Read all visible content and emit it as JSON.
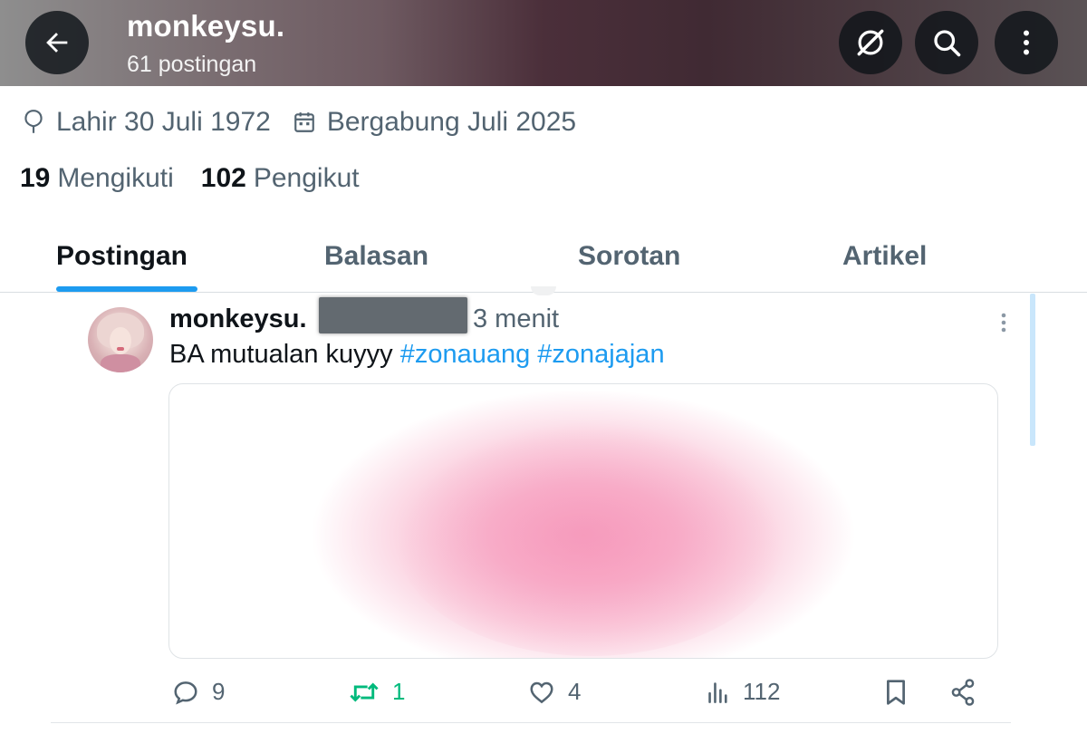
{
  "header": {
    "title": "monkeysu.",
    "post_count": "61 postingan"
  },
  "profile": {
    "birth": "Lahir 30 Juli 1972",
    "joined": "Bergabung Juli 2025",
    "following_count": "19",
    "following_label": "Mengikuti",
    "followers_count": "102",
    "followers_label": "Pengikut"
  },
  "tabs": [
    {
      "label": "Postingan",
      "active": true
    },
    {
      "label": "Balasan",
      "active": false
    },
    {
      "label": "Sorotan",
      "active": false
    },
    {
      "label": "Artikel",
      "active": false
    }
  ],
  "post": {
    "author": "monkeysu.",
    "time": "3 menit",
    "text": "BA mutualan kuyyy ",
    "hashtags": [
      "#zonauang",
      "#zonajajan"
    ],
    "actions": {
      "replies": "9",
      "reposts": "1",
      "likes": "4",
      "views": "112"
    }
  },
  "colors": {
    "accent": "#1d9bf0",
    "repost_active": "#00ba7c",
    "muted_text": "#536471"
  },
  "icons": [
    "back-arrow-icon",
    "grok-icon",
    "search-icon",
    "more-vertical-icon",
    "location-icon",
    "calendar-icon",
    "reply-icon",
    "repost-icon",
    "like-icon",
    "views-icon",
    "bookmark-icon",
    "share-icon"
  ]
}
